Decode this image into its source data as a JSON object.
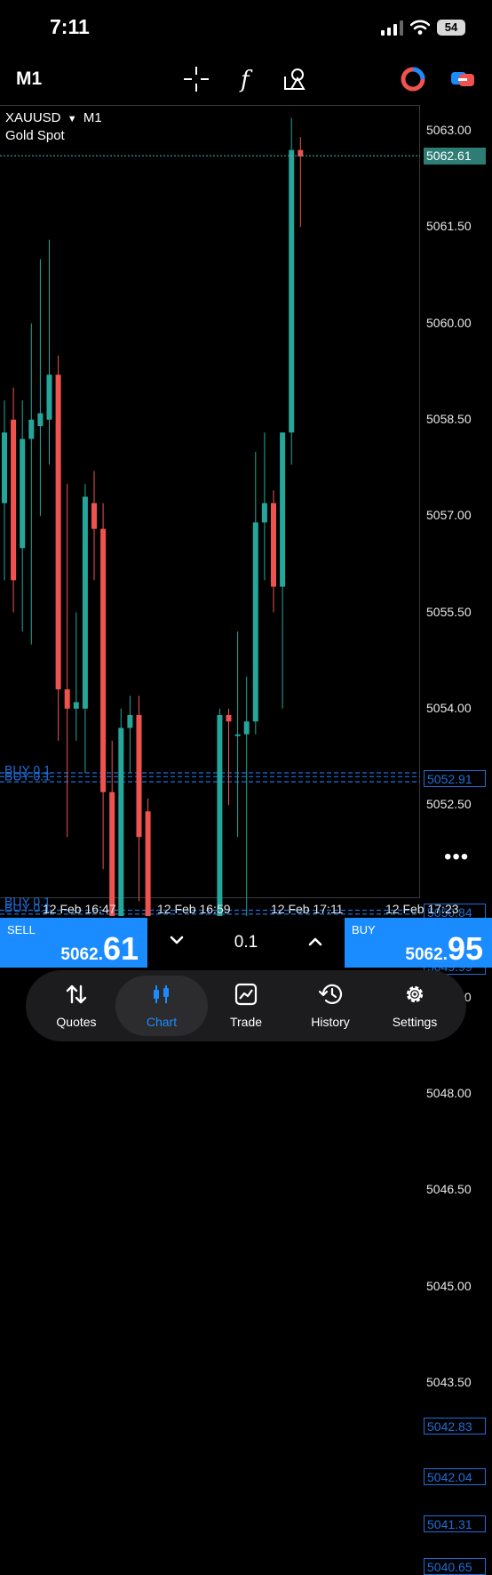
{
  "status_bar": {
    "time": "7:11",
    "battery": "54"
  },
  "toolbar": {
    "timeframe": "M1",
    "icons": [
      "crosshair-icon",
      "indicators-icon",
      "objects-icon",
      "one-click-trading-icon",
      "account-icon"
    ]
  },
  "chart": {
    "symbol": "XAUUSD",
    "period": "M1",
    "description": "Gold Spot",
    "price_axis": [
      "5063.00",
      "5061.50",
      "5060.00",
      "5058.50",
      "5057.00",
      "5055.50",
      "5054.00",
      "5052.50",
      "5049.50",
      "5048.00",
      "5046.50",
      "5045.00",
      "5043.50"
    ],
    "current_price": "5062.61",
    "order_price_boxes": [
      "5052.91",
      "5050.84",
      "5049.99",
      "5042.83",
      "5042.04",
      "5041.31",
      "5040.65"
    ],
    "position_label": "BUY 0.1",
    "time_axis": [
      "12 Feb 16:47",
      "12 Feb 16:59",
      "12 Feb 17:11",
      "12 Feb 17:23"
    ],
    "up_color": "#26a69a",
    "down_color": "#ef5350",
    "order_line_color": "#1e6fd9",
    "more_label": "•••"
  },
  "trade_bar": {
    "sell": {
      "caption": "SELL",
      "price_prefix": "5062.",
      "price_big": "61"
    },
    "buy": {
      "caption": "BUY",
      "price_prefix": "5062.",
      "price_big": "95"
    },
    "lot": "0.1"
  },
  "nav": {
    "items": [
      {
        "label": "Quotes",
        "icon": "quotes-icon"
      },
      {
        "label": "Chart",
        "icon": "chart-icon"
      },
      {
        "label": "Trade",
        "icon": "trade-icon"
      },
      {
        "label": "History",
        "icon": "history-icon"
      },
      {
        "label": "Settings",
        "icon": "settings-icon"
      }
    ],
    "active": "Chart",
    "active_color": "#1a8cff"
  }
}
